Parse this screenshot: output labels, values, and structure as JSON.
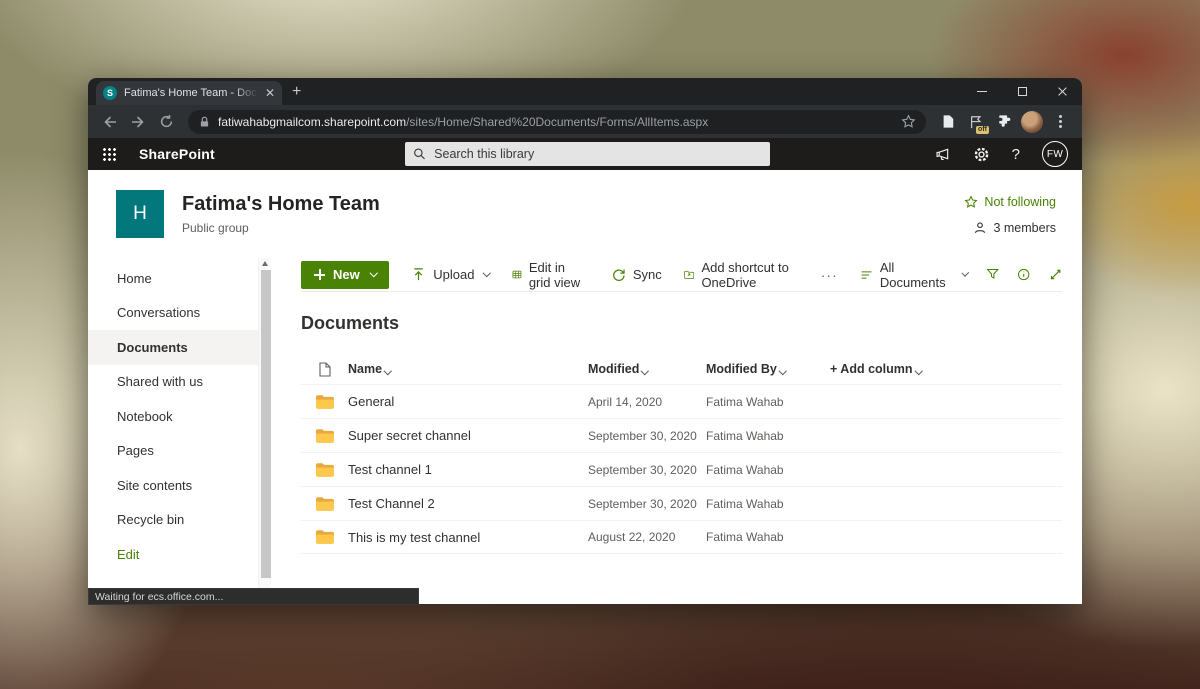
{
  "browser": {
    "tab_title": "Fatima's Home Team - Documen",
    "close_tab_glyph": "✕",
    "new_tab_label": "+",
    "url": {
      "domain": "fatiwahabgmailcom.sharepoint.com",
      "path": "/sites/Home/Shared%20Documents/Forms/AllItems.aspx"
    },
    "extension_badge": "off",
    "status_text": "Waiting for ecs.office.com..."
  },
  "suitebar": {
    "app_name": "SharePoint",
    "search_placeholder": "Search this library",
    "help_label": "?",
    "avatar_initials": "FW"
  },
  "site_header": {
    "logo_letter": "H",
    "title": "Fatima's Home Team",
    "subtitle": "Public group",
    "follow_label": "Not following",
    "members_label": "3 members"
  },
  "sidebar": {
    "items": [
      {
        "label": "Home"
      },
      {
        "label": "Conversations"
      },
      {
        "label": "Documents",
        "selected": true
      },
      {
        "label": "Shared with us"
      },
      {
        "label": "Notebook"
      },
      {
        "label": "Pages"
      },
      {
        "label": "Site contents"
      },
      {
        "label": "Recycle bin"
      },
      {
        "label": "Edit",
        "accent": true
      }
    ]
  },
  "command_bar": {
    "new_label": "New",
    "upload_label": "Upload",
    "grid_view_label": "Edit in grid view",
    "sync_label": "Sync",
    "onedrive_label": "Add shortcut to OneDrive",
    "more_label": "···",
    "view_selector_label": "All Documents"
  },
  "library": {
    "heading": "Documents",
    "columns": {
      "name": "Name",
      "modified": "Modified",
      "modified_by": "Modified By",
      "add_column": "+ Add column"
    },
    "rows": [
      {
        "name": "General",
        "modified": "April 14, 2020",
        "modified_by": "Fatima Wahab"
      },
      {
        "name": "Super secret channel",
        "modified": "September 30, 2020",
        "modified_by": "Fatima Wahab"
      },
      {
        "name": "Test channel 1",
        "modified": "September 30, 2020",
        "modified_by": "Fatima Wahab"
      },
      {
        "name": "Test Channel 2",
        "modified": "September 30, 2020",
        "modified_by": "Fatima Wahab"
      },
      {
        "name": "This is my test channel",
        "modified": "August 22, 2020",
        "modified_by": "Fatima Wahab"
      }
    ]
  },
  "colors": {
    "theme_green": "#498205",
    "site_logo_teal": "#03787c",
    "folder_yellow": "#FDC84B",
    "browser_dark": "#1f2123"
  }
}
